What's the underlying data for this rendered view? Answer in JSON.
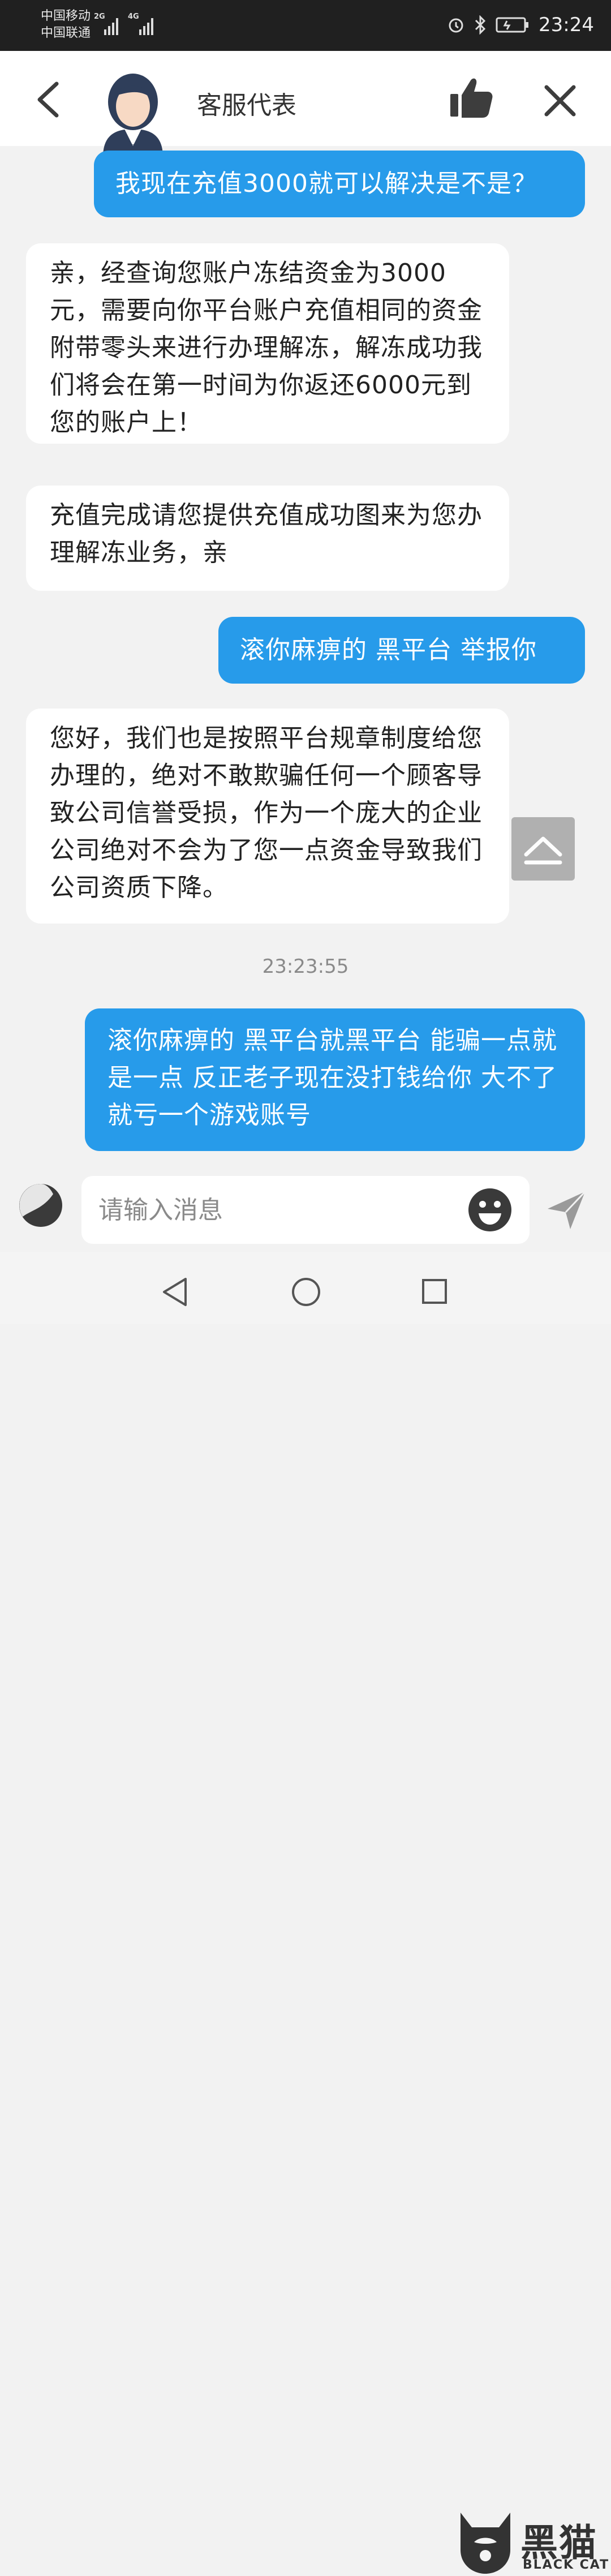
{
  "status_bar": {
    "carrier1": "中国移动",
    "carrier2": "中国联通",
    "net1": "2G",
    "net2": "4G",
    "time": "23:24"
  },
  "header": {
    "title": "客服代表"
  },
  "messages": [
    {
      "text": "我现在充值3000就可以解决是不是？"
    },
    {
      "text": "亲，经查询您账户冻结资金为3000元，需要向你平台账户充值相同的资金附带零头来进行办理解冻，解冻成功我们将会在第一时间为你返还6000元到您的账户上！"
    },
    {
      "text": "充值完成请您提供充值成功图来为您办理解冻业务，亲"
    },
    {
      "text": "滚你麻痹的 黑平台 举报你"
    },
    {
      "text": "您好，我们也是按照平台规章制度给您办理的，绝对不敢欺骗任何一个顾客导致公司信誉受损，作为一个庞大的企业公司绝对不会为了您一点资金导致我们公司资质下降。"
    },
    {
      "text": "滚你麻痹的 黑平台就黑平台 能骗一点就是一点 反正老子现在没打钱给你 大不了就亏一个游戏账号"
    }
  ],
  "timestamp": "23:23:55",
  "input": {
    "placeholder": "请输入消息"
  },
  "watermark": {
    "cn": "黑猫",
    "en": "BLACK CAT"
  },
  "colors": {
    "outgoing_bubble": "#279bea",
    "incoming_bubble": "#ffffff",
    "status_bar": "#202020"
  }
}
